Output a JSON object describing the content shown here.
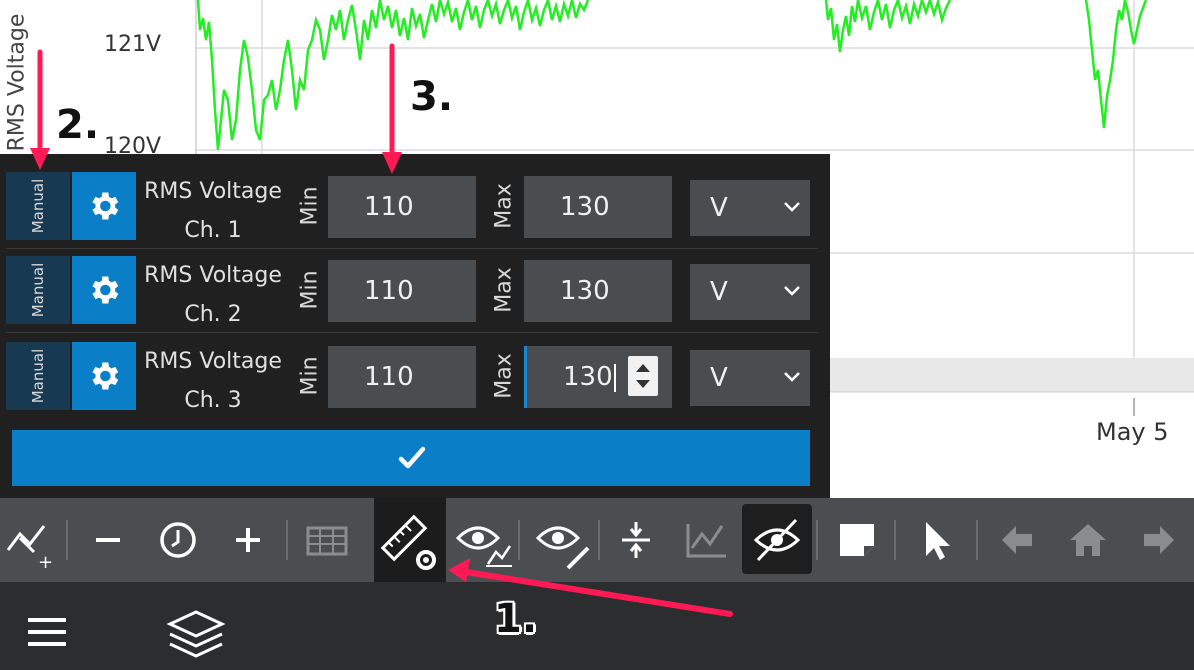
{
  "chart": {
    "y_axis_label": "RMS Voltage",
    "y_ticks": [
      "121V",
      "120V"
    ],
    "x_ticks": [
      "May 5"
    ],
    "line_color": "#22ee22"
  },
  "panel": {
    "rows": [
      {
        "mode": "Manual",
        "name_line1": "RMS Voltage",
        "name_line2": "Ch. 1",
        "min_label": "Min",
        "min_value": "110",
        "max_label": "Max",
        "max_value": "130",
        "unit": "V"
      },
      {
        "mode": "Manual",
        "name_line1": "RMS Voltage",
        "name_line2": "Ch. 2",
        "min_label": "Min",
        "min_value": "110",
        "max_label": "Max",
        "max_value": "130",
        "unit": "V"
      },
      {
        "mode": "Manual",
        "name_line1": "RMS Voltage",
        "name_line2": "Ch. 3",
        "min_label": "Min",
        "min_value": "110",
        "max_label": "Max",
        "max_value": "130",
        "unit": "V"
      }
    ],
    "confirm_icon": "checkmark-icon",
    "accent_color": "#0a7fc8"
  },
  "toolbar": {
    "icons": [
      "add-chart-icon",
      "zoom-out-icon",
      "clock-icon",
      "zoom-in-icon",
      "table-icon",
      "ruler-settings-icon",
      "view-chart-icon",
      "view-edit-icon",
      "compress-vertical-icon",
      "chart-line-icon",
      "hide-icon",
      "note-icon",
      "cursor-icon",
      "arrow-left-icon",
      "home-icon",
      "arrow-right-icon"
    ]
  },
  "bottom_bar": {
    "icons": [
      "menu-icon",
      "layers-icon"
    ]
  },
  "annotations": {
    "label_1": "1.",
    "label_2": "2.",
    "label_3": "3.",
    "arrow_color": "#ff1a55"
  }
}
